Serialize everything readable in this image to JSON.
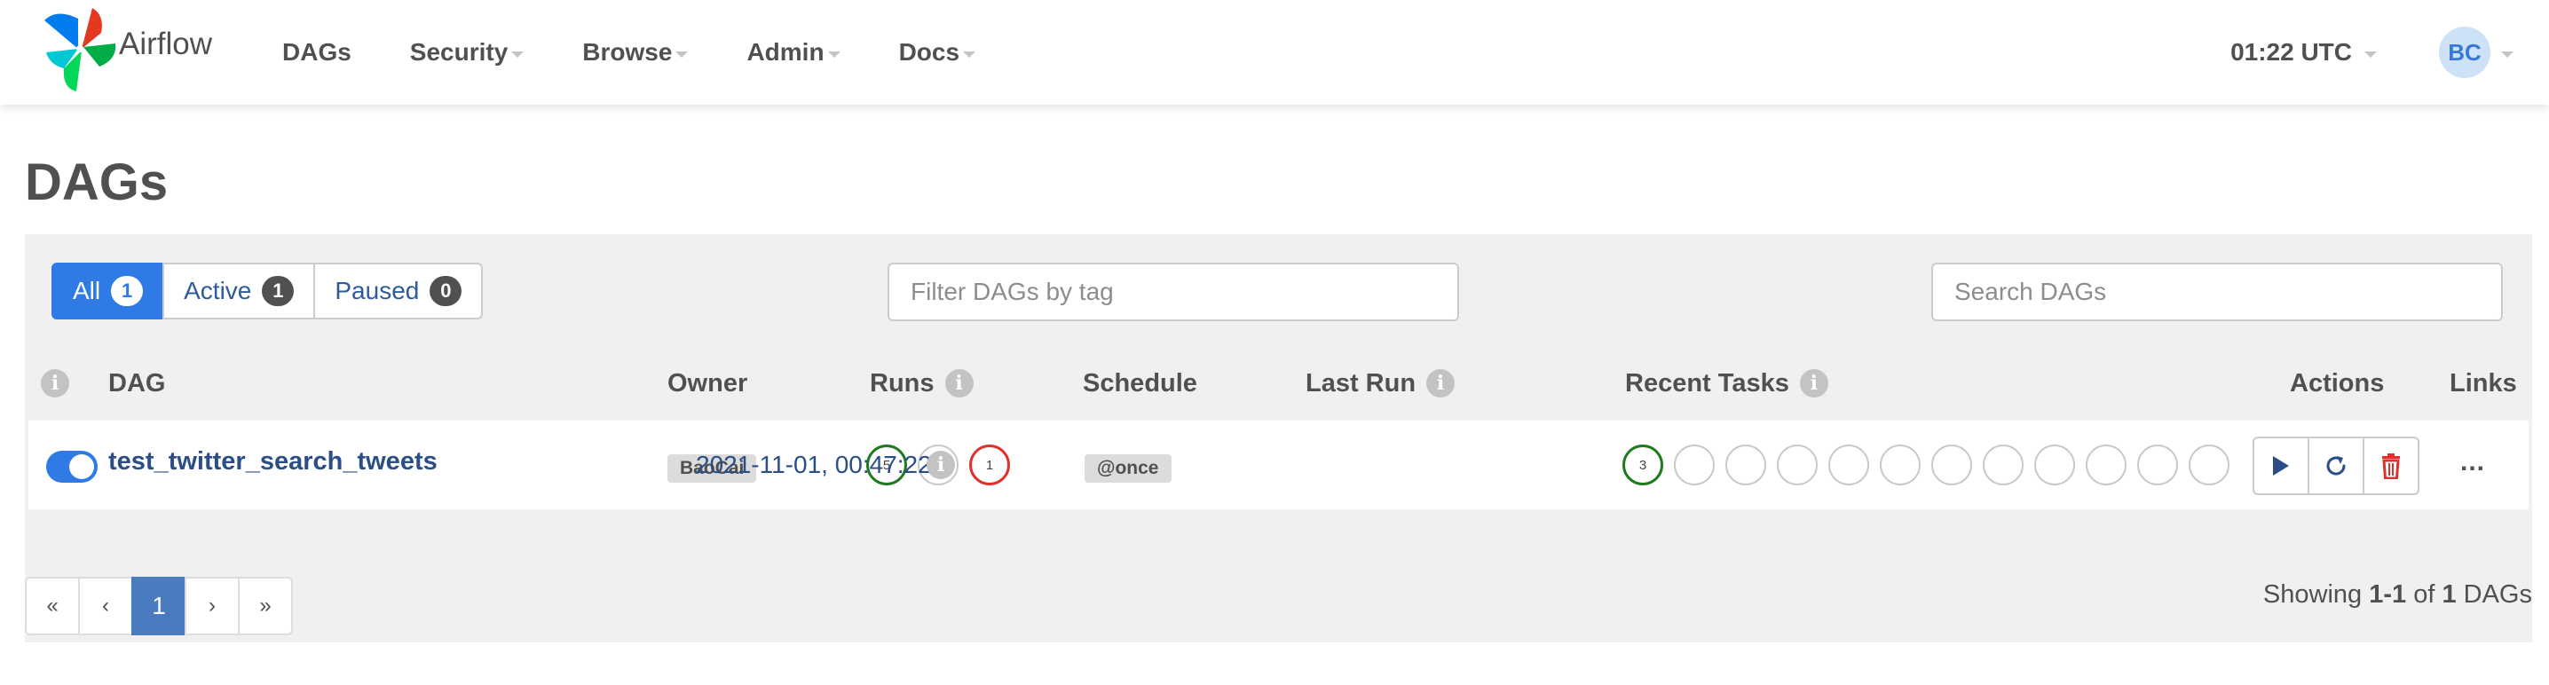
{
  "brand": {
    "name": "Airflow"
  },
  "nav": {
    "items": [
      {
        "label": "DAGs",
        "dropdown": false
      },
      {
        "label": "Security",
        "dropdown": true
      },
      {
        "label": "Browse",
        "dropdown": true
      },
      {
        "label": "Admin",
        "dropdown": true
      },
      {
        "label": "Docs",
        "dropdown": true
      }
    ],
    "clock": "01:22 UTC",
    "user_initials": "BC"
  },
  "page": {
    "title": "DAGs"
  },
  "filters": {
    "all_label": "All",
    "all_count": "1",
    "active_label": "Active",
    "active_count": "1",
    "paused_label": "Paused",
    "paused_count": "0",
    "tag_placeholder": "Filter DAGs by tag",
    "search_placeholder": "Search DAGs"
  },
  "table": {
    "headers": {
      "dag": "DAG",
      "owner": "Owner",
      "runs": "Runs",
      "schedule": "Schedule",
      "last_run": "Last Run",
      "recent_tasks": "Recent Tasks",
      "actions": "Actions",
      "links": "Links"
    },
    "rows": [
      {
        "enabled": true,
        "dag_id": "test_twitter_search_tweets",
        "owner": "BaoCai",
        "runs": {
          "success": "5",
          "running": "",
          "failed": "1"
        },
        "schedule": "@once",
        "last_run": "2021-11-01, 00:47:22",
        "recent_tasks": {
          "success": "3",
          "other_states": 11
        },
        "links_label": "..."
      }
    ]
  },
  "pagination": {
    "first": "«",
    "prev": "‹",
    "current": "1",
    "next": "›",
    "last": "»"
  },
  "summary": {
    "prefix": "Showing ",
    "range": "1-1",
    "of": " of ",
    "total": "1",
    "suffix": " DAGs"
  },
  "colors": {
    "accent": "#2f7ae5",
    "success": "#1f7a1f",
    "failed": "#e0312f",
    "link": "#2a4e85",
    "pagination_active": "#4a7bbf",
    "delete": "#d9342b"
  },
  "icons": {
    "play": "play-icon",
    "refresh": "refresh-icon",
    "delete": "trash-icon",
    "info": "info-icon"
  }
}
